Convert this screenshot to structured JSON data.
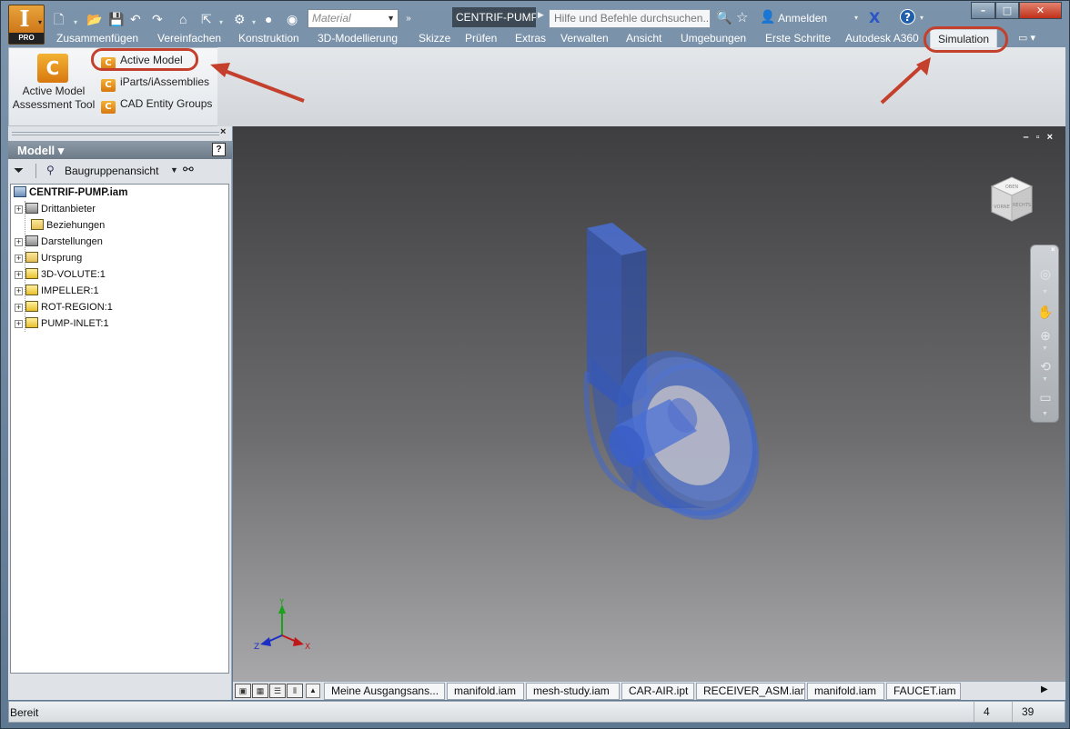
{
  "colors": {
    "accent": "#c4402d",
    "titlebar": "#6f8aa3",
    "part_blue": "#3b66d6"
  },
  "quick_access": {
    "material_placeholder": "Material",
    "document_title": "CENTRIF-PUMP...",
    "search_placeholder": "Hilfe und Befehle durchsuchen...",
    "signin_label": "Anmelden",
    "help_label": "?",
    "exchange_label": "X"
  },
  "app_button": {
    "logo": "I",
    "edition": "PRO"
  },
  "window_controls": {
    "minimize": "–",
    "maximize": "□",
    "close": "✕"
  },
  "ribbon_tabs": [
    "Zusammenfügen",
    "Vereinfachen",
    "Konstruktion",
    "3D-Modellierung",
    "Skizze",
    "Prüfen",
    "Extras",
    "Verwalten",
    "Ansicht",
    "Umgebungen",
    "Erste Schritte",
    "Autodesk A360",
    "Simulation"
  ],
  "ribbon": {
    "big_button_label_line1": "Active Model",
    "big_button_label_line2": "Assessment Tool",
    "items": [
      "Active Model",
      "iParts/iAssemblies",
      "CAD Entity Groups"
    ]
  },
  "browser": {
    "title": "Modell ▾",
    "help": "?",
    "view_label": "Baugruppenansicht",
    "tree": [
      {
        "label": "CENTRIF-PUMP.iam",
        "icon": "assembly-icon",
        "expander": ""
      },
      {
        "label": "Drittanbieter",
        "icon": "third-party-icon",
        "expander": "+"
      },
      {
        "label": "Beziehungen",
        "icon": "folder-icon",
        "expander": ""
      },
      {
        "label": "Darstellungen",
        "icon": "representations-icon",
        "expander": "+"
      },
      {
        "label": "Ursprung",
        "icon": "folder-icon",
        "expander": "+"
      },
      {
        "label": "3D-VOLUTE:1",
        "icon": "part-icon",
        "expander": "+"
      },
      {
        "label": "IMPELLER:1",
        "icon": "part-icon",
        "expander": "+"
      },
      {
        "label": "ROT-REGION:1",
        "icon": "part-icon",
        "expander": "+"
      },
      {
        "label": "PUMP-INLET:1",
        "icon": "part-icon",
        "expander": "+"
      }
    ]
  },
  "viewcube": {
    "top": "OBEN",
    "front": "VORNE",
    "right": "RECHTS"
  },
  "triad": {
    "x": "X",
    "y": "Y",
    "z": "Z"
  },
  "document_tabs": [
    "Meine Ausgangsans...",
    "manifold.iam",
    "mesh-study.iam",
    "CAR-AIR.ipt",
    "RECEIVER_ASM.iam",
    "manifold.iam",
    "FAUCET.iam"
  ],
  "status": {
    "text": "Bereit",
    "count1": "4",
    "count2": "39"
  }
}
